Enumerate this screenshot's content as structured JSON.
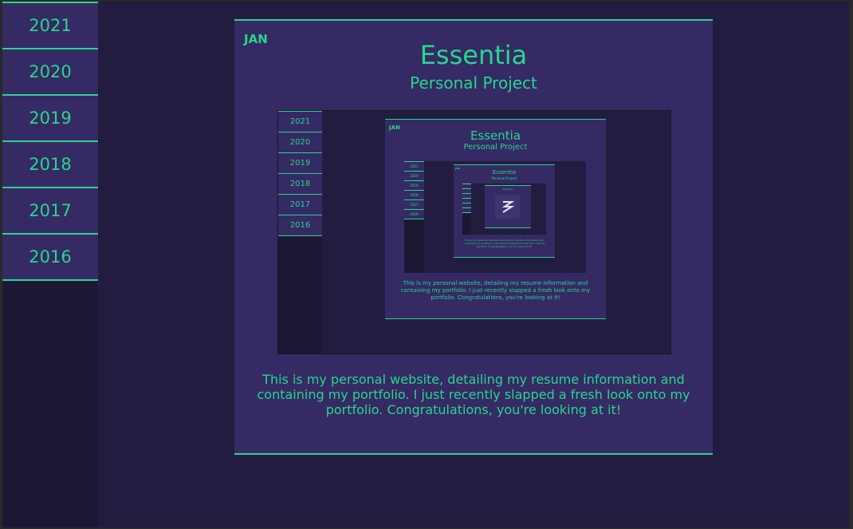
{
  "sidebar": {
    "years": [
      "2021",
      "2020",
      "2019",
      "2018",
      "2017",
      "2016"
    ]
  },
  "project": {
    "month": "JAN",
    "title": "Essentia",
    "subtitle": "Personal Project",
    "description": "This is my personal website, detailing my resume information and containing my portfolio. I just recently slapped a fresh look onto my portfolio. Congratulations, you're looking at it!"
  },
  "colors": {
    "accent": "#27d68e",
    "background": "#221c40",
    "sidebar": "#1c1833",
    "card": "#352a63"
  }
}
